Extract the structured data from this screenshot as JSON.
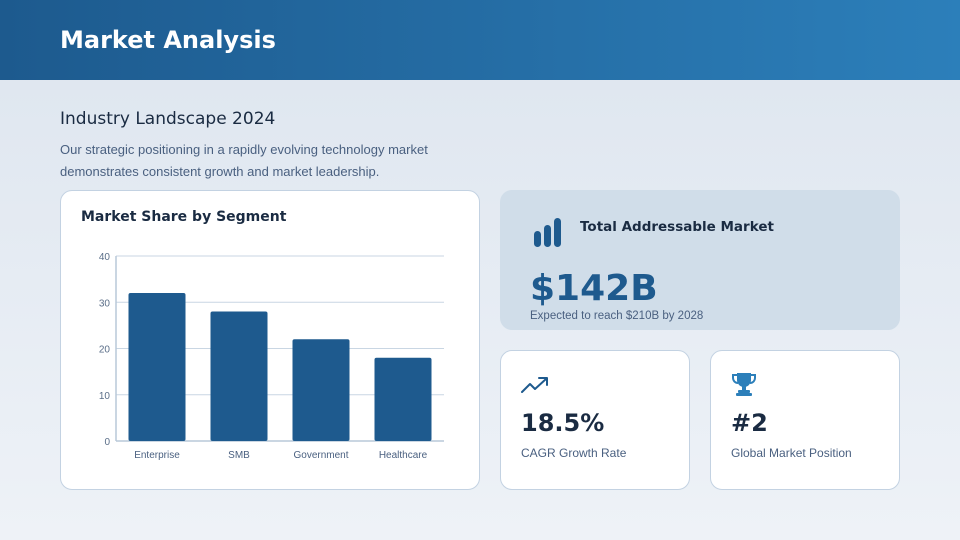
{
  "header": {
    "title": "Market Analysis"
  },
  "intro": {
    "subtitle": "Industry Landscape 2024",
    "description": "Our strategic positioning in a rapidly evolving technology market demonstrates consistent growth and market leadership."
  },
  "chart_data": {
    "type": "bar",
    "title": "Market Share by Segment",
    "categories": [
      "Enterprise",
      "SMB",
      "Government",
      "Healthcare"
    ],
    "values": [
      32,
      28,
      22,
      18
    ],
    "yticks": [
      "0",
      "10",
      "20",
      "30",
      "40"
    ],
    "ylim": [
      0,
      40
    ],
    "xlabel": "",
    "ylabel": "",
    "grid": true,
    "bar_color": "#1e5a8e"
  },
  "tam": {
    "icon": "bar-chart-icon",
    "title": "Total Addressable Market",
    "value": "$142B",
    "note": "Expected to reach $210B by 2028"
  },
  "stats": [
    {
      "icon": "trending-up-icon",
      "value": "18.5%",
      "label": "CAGR Growth Rate"
    },
    {
      "icon": "trophy-icon",
      "value": "#2",
      "label": "Global Market Position"
    }
  ],
  "colors": {
    "accent": "#1e5a8e",
    "trophy": "#2c7fba"
  }
}
